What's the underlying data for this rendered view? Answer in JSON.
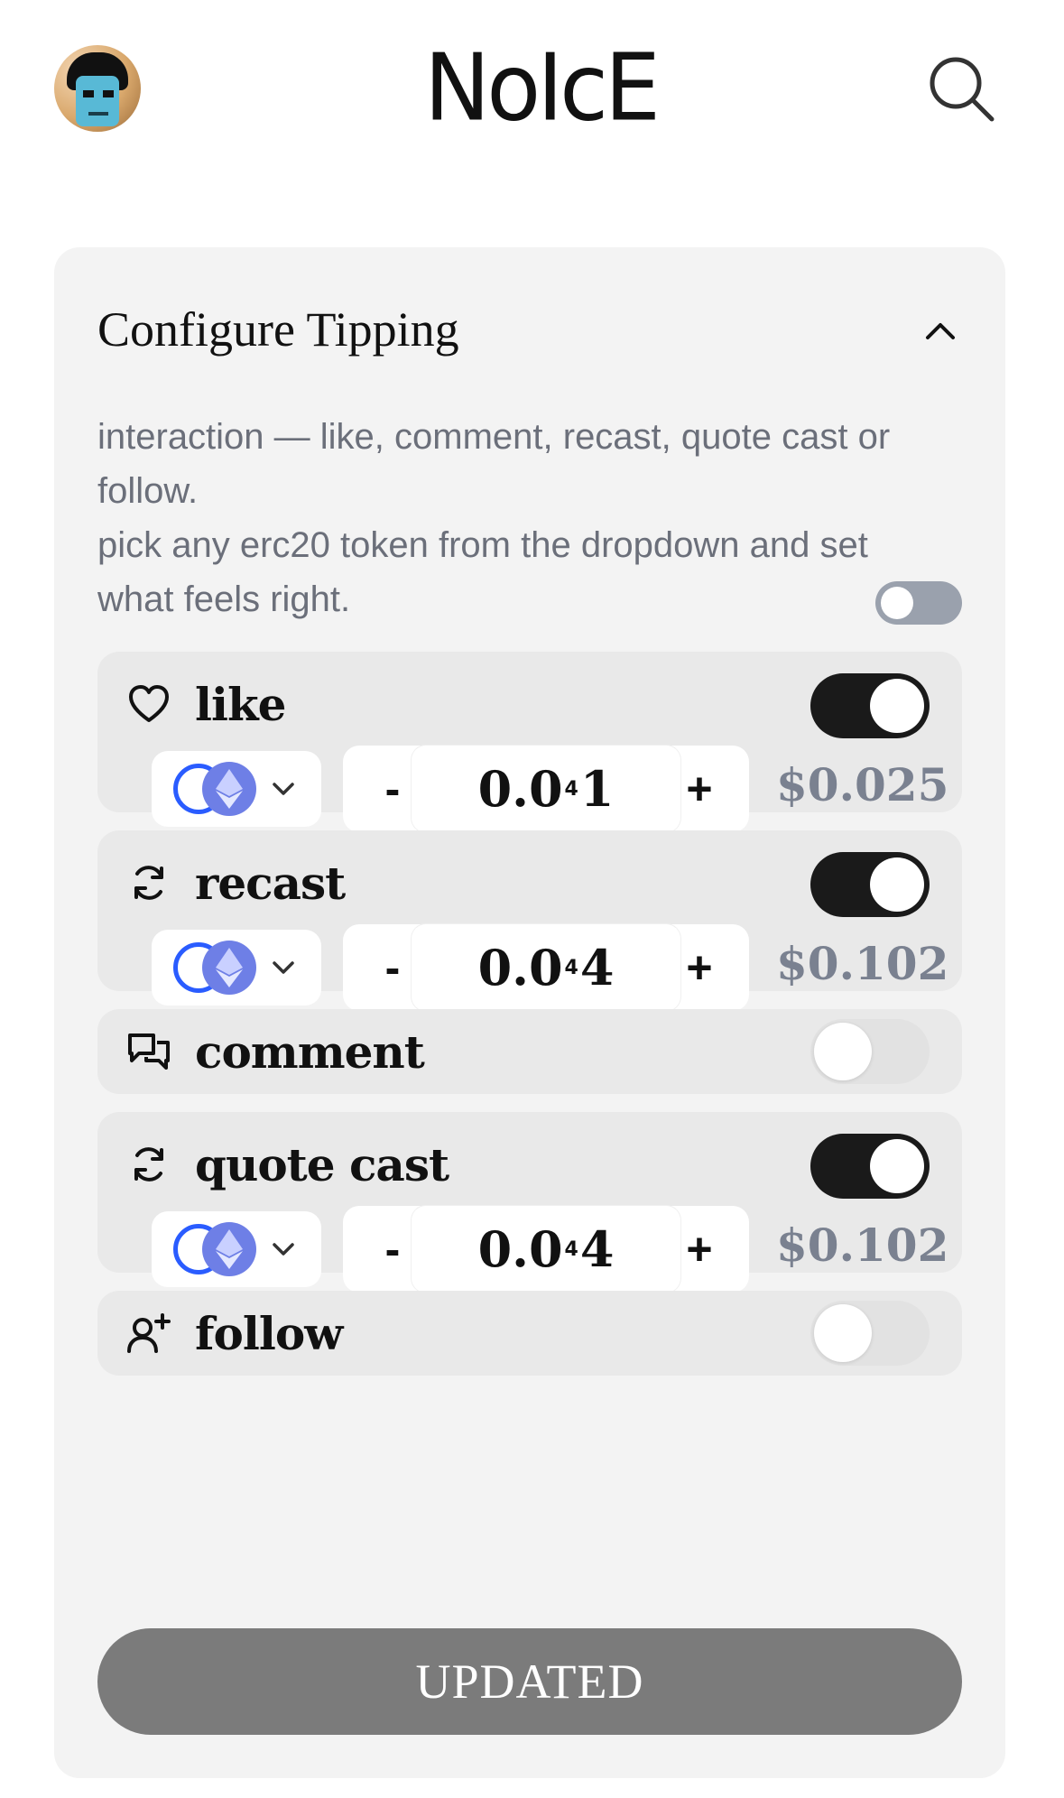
{
  "header": {
    "logo": "NoIcE",
    "search_icon": "search-icon",
    "avatar_icon": "avatar"
  },
  "card": {
    "title": "Configure Tipping",
    "collapse_icon": "chevron-up-icon",
    "description_lines": [
      "interaction — like, comment, recast, quote cast or follow.",
      "pick any erc20 token from the dropdown and set what feels right."
    ],
    "master_toggle_on": false
  },
  "rows": {
    "like": {
      "label": "like",
      "icon": "heart-icon",
      "enabled": true,
      "token": "ETH",
      "amount_prefix": "0.0",
      "amount_sub": "4",
      "amount_suffix": "1",
      "usd": "$0.025"
    },
    "recast": {
      "label": "recast",
      "icon": "refresh-icon",
      "enabled": true,
      "token": "ETH",
      "amount_prefix": "0.0",
      "amount_sub": "4",
      "amount_suffix": "4",
      "usd": "$0.102"
    },
    "comment": {
      "label": "comment",
      "icon": "chat-bubbles-icon",
      "enabled": false
    },
    "quote_cast": {
      "label": "quote cast",
      "icon": "refresh-icon",
      "enabled": true,
      "token": "ETH",
      "amount_prefix": "0.0",
      "amount_sub": "4",
      "amount_suffix": "4",
      "usd": "$0.102"
    },
    "follow": {
      "label": "follow",
      "icon": "user-plus-icon",
      "enabled": false
    }
  },
  "stepper": {
    "minus": "-",
    "plus": "+"
  },
  "update_button": "UPDATED",
  "colors": {
    "toggle_on": "#1a1a1a",
    "toggle_off": "#e2e2e2",
    "master_toggle_off": "#9aa1ad",
    "token_blue": "#2a5cff",
    "eth_purple": "#6e7fe6",
    "usd_gray": "#7a8190",
    "button_gray": "#7b7b7b"
  }
}
